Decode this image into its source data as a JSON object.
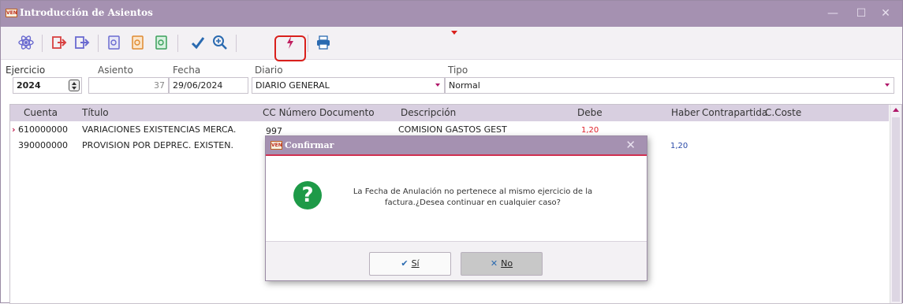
{
  "window": {
    "title": "Introducción de Asientos",
    "icon_text": "VEN",
    "controls": {
      "minimize": "—",
      "maximize": "☐",
      "close": "✕"
    }
  },
  "toolbar": {
    "buttons": [
      {
        "name": "atom-icon",
        "color": "#6a6ad0"
      },
      {
        "name": "exit-icon",
        "color": "#d84040"
      },
      {
        "name": "export-icon",
        "color": "#6a6ad0"
      },
      {
        "name": "doc-preview-icon",
        "color": "#6a6ad0"
      },
      {
        "name": "doc-orange-icon",
        "color": "#e08a30"
      },
      {
        "name": "doc-green-icon",
        "color": "#3aa05a"
      },
      {
        "name": "check-icon",
        "color": "#2a6ab0"
      },
      {
        "name": "zoom-icon",
        "color": "#2a6ab0"
      },
      {
        "name": "lightning-icon",
        "color": "#c02060"
      },
      {
        "name": "printer-icon",
        "color": "#2a6ab0"
      }
    ]
  },
  "header": {
    "ejercicio_label": "Ejercicio",
    "ejercicio_value": "2024",
    "asiento_label": "Asiento",
    "asiento_value": "37",
    "fecha_label": "Fecha",
    "fecha_value": "29/06/2024",
    "diario_label": "Diario",
    "diario_value": "DIARIO GENERAL",
    "tipo_label": "Tipo",
    "tipo_value": "Normal"
  },
  "grid": {
    "columns": [
      "Cuenta",
      "Título",
      "CC Número Documento",
      "Descripción",
      "Debe",
      "Haber",
      "Contrapartida",
      "C.Coste"
    ],
    "rows": [
      {
        "cuenta": "610000000",
        "titulo": "VARIACIONES EXISTENCIAS MERCA.",
        "documento": "997",
        "descripcion": "COMISION GASTOS GEST",
        "debe": "1,20",
        "haber": ""
      },
      {
        "cuenta": "390000000",
        "titulo": "PROVISION POR DEPREC. EXISTEN.",
        "documento": "",
        "descripcion": "",
        "debe": "",
        "haber": "1,20"
      }
    ]
  },
  "dialog": {
    "title": "Confirmar",
    "message": "La Fecha de Anulación no pertenece al mismo ejercicio de la factura.¿Desea continuar en cualquier caso?",
    "yes_label": "Sí",
    "no_label": "No"
  },
  "colors": {
    "titlebar": "#a591b1",
    "header_row": "#d8cfe0",
    "accent_red": "#d9201c",
    "question_green": "#1e9a48"
  }
}
